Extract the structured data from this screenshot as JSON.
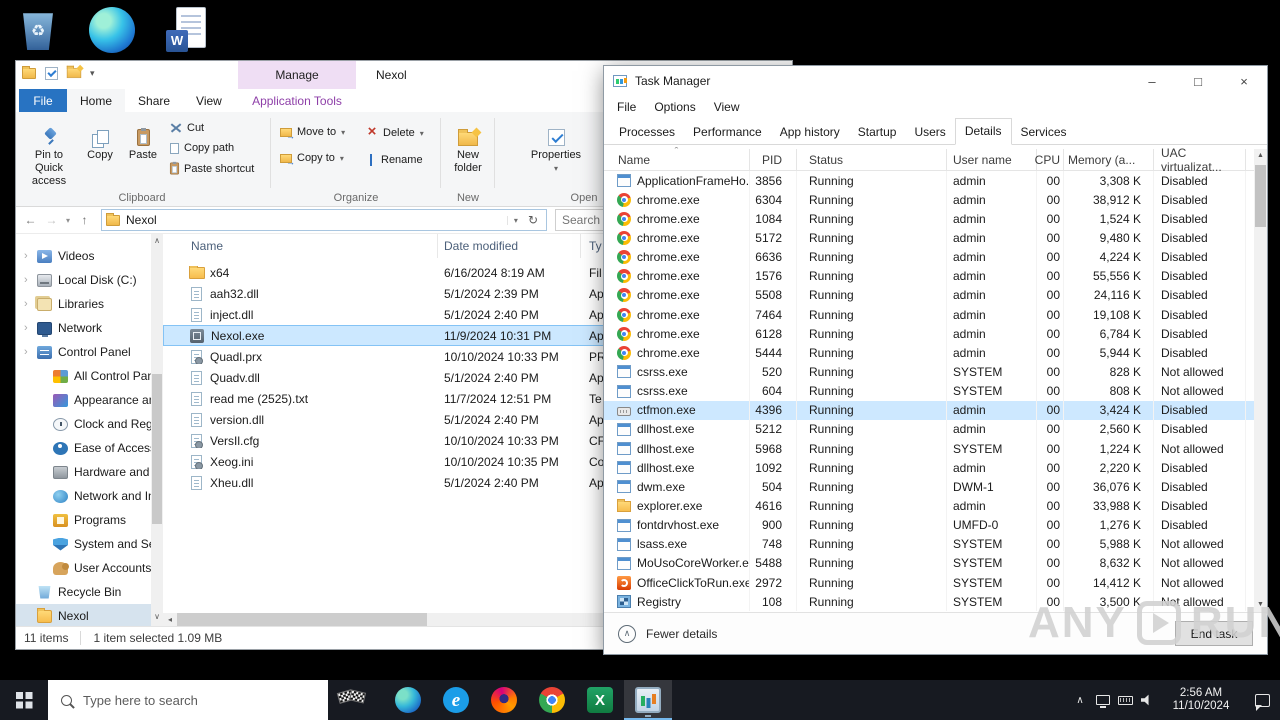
{
  "desktop_icons": [
    {
      "name": "recycle-bin"
    },
    {
      "name": "microsoft-edge"
    },
    {
      "name": "word-document"
    }
  ],
  "explorer": {
    "contextual_tab": "Manage",
    "contextual_group": "Application Tools",
    "title": "Nexol",
    "tabs": {
      "file": "File",
      "home": "Home",
      "share": "Share",
      "view": "View"
    },
    "ribbon": {
      "pin": "Pin to Quick access",
      "copy": "Copy",
      "paste": "Paste",
      "cut": "Cut",
      "copy_path": "Copy path",
      "paste_shortcut": "Paste shortcut",
      "clipboard_group": "Clipboard",
      "move_to": "Move to",
      "copy_to": "Copy to",
      "delete": "Delete",
      "rename": "Rename",
      "organize_group": "Organize",
      "new_folder": "New folder",
      "new_group": "New",
      "properties": "Properties",
      "open_group": "Open"
    },
    "address": {
      "path": "Nexol",
      "search_placeholder": "Search Nexol"
    },
    "sidebar": [
      {
        "label": "Videos",
        "icon": "si-videos",
        "state": "has-chev"
      },
      {
        "label": "Local Disk (C:)",
        "icon": "si-disk",
        "state": "has-chev"
      },
      {
        "label": "Libraries",
        "icon": "si-lib",
        "state": "has-chev"
      },
      {
        "label": "Network",
        "icon": "si-net",
        "state": "has-chev"
      },
      {
        "label": "Control Panel",
        "icon": "si-cpanel",
        "state": "has-chev"
      },
      {
        "label": "All Control Pan",
        "icon": "si-grid",
        "state": "indent"
      },
      {
        "label": "Appearance an",
        "icon": "si-appearance",
        "state": "indent"
      },
      {
        "label": "Clock and Regi",
        "icon": "si-clock",
        "state": "indent"
      },
      {
        "label": "Ease of Access",
        "icon": "si-ease",
        "state": "indent"
      },
      {
        "label": "Hardware and",
        "icon": "si-hardware",
        "state": "indent"
      },
      {
        "label": "Network and In",
        "icon": "si-globe",
        "state": "indent"
      },
      {
        "label": "Programs",
        "icon": "si-programs",
        "state": "indent"
      },
      {
        "label": "System and Se",
        "icon": "si-shield",
        "state": "indent"
      },
      {
        "label": "User Accounts",
        "icon": "si-users",
        "state": "indent"
      },
      {
        "label": "Recycle Bin",
        "icon": "si-bin",
        "state": ""
      },
      {
        "label": "Nexol",
        "icon": "si-folder",
        "state": "selected"
      }
    ],
    "columns": {
      "name": "Name",
      "date": "Date modified",
      "type": "Ty"
    },
    "files": [
      {
        "name": "x64",
        "date": "6/16/2024 8:19 AM",
        "type": "Fil",
        "icon": "fi-folder",
        "state": ""
      },
      {
        "name": "aah32.dll",
        "date": "5/1/2024 2:39 PM",
        "type": "Ap",
        "icon": "fi-page",
        "state": ""
      },
      {
        "name": "inject.dll",
        "date": "5/1/2024 2:40 PM",
        "type": "Ap",
        "icon": "fi-page",
        "state": ""
      },
      {
        "name": "Nexol.exe",
        "date": "11/9/2024 10:31 PM",
        "type": "Ap",
        "icon": "fi-exe",
        "state": "selected"
      },
      {
        "name": "Quadl.prx",
        "date": "10/10/2024 10:33 PM",
        "type": "PR",
        "icon": "fi-page fi-gear",
        "state": ""
      },
      {
        "name": "Quadv.dll",
        "date": "5/1/2024 2:40 PM",
        "type": "Ap",
        "icon": "fi-page",
        "state": ""
      },
      {
        "name": "read me (2525).txt",
        "date": "11/7/2024 12:51 PM",
        "type": "Te",
        "icon": "fi-page",
        "state": ""
      },
      {
        "name": "version.dll",
        "date": "5/1/2024 2:40 PM",
        "type": "Ap",
        "icon": "fi-page",
        "state": ""
      },
      {
        "name": "VersIl.cfg",
        "date": "10/10/2024 10:33 PM",
        "type": "CF",
        "icon": "fi-page fi-gear",
        "state": ""
      },
      {
        "name": "Xeog.ini",
        "date": "10/10/2024 10:35 PM",
        "type": "Co",
        "icon": "fi-page fi-gear",
        "state": ""
      },
      {
        "name": "Xheu.dll",
        "date": "5/1/2024 2:40 PM",
        "type": "Ap",
        "icon": "fi-page",
        "state": ""
      }
    ],
    "status": {
      "items": "11 items",
      "selection": "1 item selected 1.09 MB"
    }
  },
  "taskmgr": {
    "title": "Task Manager",
    "menu": [
      {
        "label": "File"
      },
      {
        "label": "Options"
      },
      {
        "label": "View"
      }
    ],
    "tabs": [
      {
        "label": "Processes",
        "state": ""
      },
      {
        "label": "Performance",
        "state": ""
      },
      {
        "label": "App history",
        "state": ""
      },
      {
        "label": "Startup",
        "state": ""
      },
      {
        "label": "Users",
        "state": ""
      },
      {
        "label": "Details",
        "state": "active"
      },
      {
        "label": "Services",
        "state": ""
      }
    ],
    "columns": [
      "Name",
      "PID",
      "Status",
      "User name",
      "CPU",
      "Memory (a...",
      "UAC virtualizat..."
    ],
    "rows": [
      {
        "icon": "ic-win",
        "name": "ApplicationFrameHo...",
        "pid": "3856",
        "status": "Running",
        "user": "admin",
        "cpu": "00",
        "mem": "3,308 K",
        "uac": "Disabled",
        "state": ""
      },
      {
        "icon": "ic-chrome",
        "name": "chrome.exe",
        "pid": "6304",
        "status": "Running",
        "user": "admin",
        "cpu": "00",
        "mem": "38,912 K",
        "uac": "Disabled",
        "state": ""
      },
      {
        "icon": "ic-chrome",
        "name": "chrome.exe",
        "pid": "1084",
        "status": "Running",
        "user": "admin",
        "cpu": "00",
        "mem": "1,524 K",
        "uac": "Disabled",
        "state": ""
      },
      {
        "icon": "ic-chrome",
        "name": "chrome.exe",
        "pid": "5172",
        "status": "Running",
        "user": "admin",
        "cpu": "00",
        "mem": "9,480 K",
        "uac": "Disabled",
        "state": ""
      },
      {
        "icon": "ic-chrome",
        "name": "chrome.exe",
        "pid": "6636",
        "status": "Running",
        "user": "admin",
        "cpu": "00",
        "mem": "4,224 K",
        "uac": "Disabled",
        "state": ""
      },
      {
        "icon": "ic-chrome",
        "name": "chrome.exe",
        "pid": "1576",
        "status": "Running",
        "user": "admin",
        "cpu": "00",
        "mem": "55,556 K",
        "uac": "Disabled",
        "state": ""
      },
      {
        "icon": "ic-chrome",
        "name": "chrome.exe",
        "pid": "5508",
        "status": "Running",
        "user": "admin",
        "cpu": "00",
        "mem": "24,116 K",
        "uac": "Disabled",
        "state": ""
      },
      {
        "icon": "ic-chrome",
        "name": "chrome.exe",
        "pid": "7464",
        "status": "Running",
        "user": "admin",
        "cpu": "00",
        "mem": "19,108 K",
        "uac": "Disabled",
        "state": ""
      },
      {
        "icon": "ic-chrome",
        "name": "chrome.exe",
        "pid": "6128",
        "status": "Running",
        "user": "admin",
        "cpu": "00",
        "mem": "6,784 K",
        "uac": "Disabled",
        "state": ""
      },
      {
        "icon": "ic-chrome",
        "name": "chrome.exe",
        "pid": "5444",
        "status": "Running",
        "user": "admin",
        "cpu": "00",
        "mem": "5,944 K",
        "uac": "Disabled",
        "state": ""
      },
      {
        "icon": "ic-win",
        "name": "csrss.exe",
        "pid": "520",
        "status": "Running",
        "user": "SYSTEM",
        "cpu": "00",
        "mem": "828 K",
        "uac": "Not allowed",
        "state": ""
      },
      {
        "icon": "ic-win",
        "name": "csrss.exe",
        "pid": "604",
        "status": "Running",
        "user": "SYSTEM",
        "cpu": "00",
        "mem": "808 K",
        "uac": "Not allowed",
        "state": ""
      },
      {
        "icon": "ic-keyboard",
        "name": "ctfmon.exe",
        "pid": "4396",
        "status": "Running",
        "user": "admin",
        "cpu": "00",
        "mem": "3,424 K",
        "uac": "Disabled",
        "state": "selected"
      },
      {
        "icon": "ic-win",
        "name": "dllhost.exe",
        "pid": "5212",
        "status": "Running",
        "user": "admin",
        "cpu": "00",
        "mem": "2,560 K",
        "uac": "Disabled",
        "state": ""
      },
      {
        "icon": "ic-win",
        "name": "dllhost.exe",
        "pid": "5968",
        "status": "Running",
        "user": "SYSTEM",
        "cpu": "00",
        "mem": "1,224 K",
        "uac": "Not allowed",
        "state": ""
      },
      {
        "icon": "ic-win",
        "name": "dllhost.exe",
        "pid": "1092",
        "status": "Running",
        "user": "admin",
        "cpu": "00",
        "mem": "2,220 K",
        "uac": "Disabled",
        "state": ""
      },
      {
        "icon": "ic-win",
        "name": "dwm.exe",
        "pid": "504",
        "status": "Running",
        "user": "DWM-1",
        "cpu": "00",
        "mem": "36,076 K",
        "uac": "Disabled",
        "state": ""
      },
      {
        "icon": "ic-folder",
        "name": "explorer.exe",
        "pid": "4616",
        "status": "Running",
        "user": "admin",
        "cpu": "00",
        "mem": "33,988 K",
        "uac": "Disabled",
        "state": ""
      },
      {
        "icon": "ic-win",
        "name": "fontdrvhost.exe",
        "pid": "900",
        "status": "Running",
        "user": "UMFD-0",
        "cpu": "00",
        "mem": "1,276 K",
        "uac": "Disabled",
        "state": ""
      },
      {
        "icon": "ic-win",
        "name": "lsass.exe",
        "pid": "748",
        "status": "Running",
        "user": "SYSTEM",
        "cpu": "00",
        "mem": "5,988 K",
        "uac": "Not allowed",
        "state": ""
      },
      {
        "icon": "ic-win",
        "name": "MoUsoCoreWorker.e...",
        "pid": "5488",
        "status": "Running",
        "user": "SYSTEM",
        "cpu": "00",
        "mem": "8,632 K",
        "uac": "Not allowed",
        "state": ""
      },
      {
        "icon": "ic-office",
        "name": "OfficeClickToRun.exe",
        "pid": "2972",
        "status": "Running",
        "user": "SYSTEM",
        "cpu": "00",
        "mem": "14,412 K",
        "uac": "Not allowed",
        "state": ""
      },
      {
        "icon": "ic-registry",
        "name": "Registry",
        "pid": "108",
        "status": "Running",
        "user": "SYSTEM",
        "cpu": "00",
        "mem": "3,500 K",
        "uac": "Not allowed",
        "state": ""
      }
    ],
    "footer": {
      "fewer_details": "Fewer details",
      "end_task": "End task"
    }
  },
  "watermark": {
    "left": "ANY",
    "right": "RUN"
  },
  "taskbar": {
    "search_placeholder": "Type here to search",
    "apps": [
      {
        "icon": "tb-edge",
        "name": "edge-icon",
        "state": ""
      },
      {
        "icon": "tb-ie",
        "name": "internet-explorer-icon",
        "state": ""
      },
      {
        "icon": "tb-firefox",
        "name": "firefox-icon",
        "state": ""
      },
      {
        "icon": "tb-chrome",
        "name": "chrome-icon",
        "state": ""
      },
      {
        "icon": "tb-excel",
        "name": "excel-icon",
        "state": ""
      },
      {
        "icon": "tb-taskmgr",
        "name": "task-manager-icon",
        "state": "active"
      }
    ],
    "clock": {
      "time": "2:56 AM",
      "date": "11/10/2024"
    }
  }
}
